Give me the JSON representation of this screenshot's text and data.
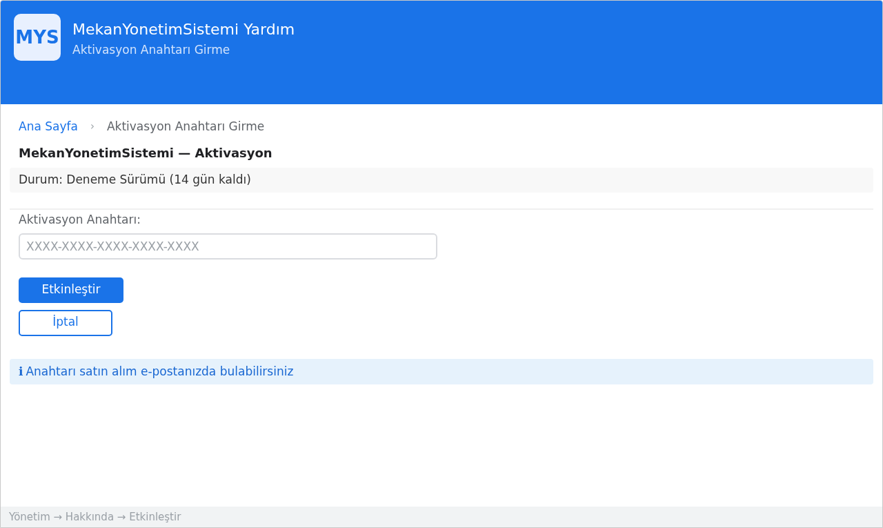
{
  "header": {
    "logo": "MYS",
    "title": "MekanYonetimSistemi Yardım",
    "subtitle": "Aktivasyon Anahtarı Girme"
  },
  "breadcrumb": [
    {
      "label": "Ana Sayfa",
      "kind": "link"
    },
    {
      "label": "›",
      "kind": "separator"
    },
    {
      "label": "Aktivasyon Anahtarı Girme",
      "kind": "current"
    }
  ],
  "heading": "MekanYonetimSistemi — Aktivasyon",
  "status": "Durum: Deneme Sürümü (14 gün kaldı)",
  "form": {
    "label": "Aktivasyon Anahtarı:",
    "placeholder": "XXXX-XXXX-XXXX-XXXX-XXXX"
  },
  "buttons": [
    {
      "label": "Etkinleştir",
      "kind": "primary"
    },
    {
      "label": "İptal",
      "kind": "outline"
    }
  ],
  "info": {
    "icon": "ℹ",
    "text": "Anahtarı satın alım e-postanızda bulabilirsiniz"
  },
  "status_bar": "Yönetim → Hakkında → Etkinleştir"
}
